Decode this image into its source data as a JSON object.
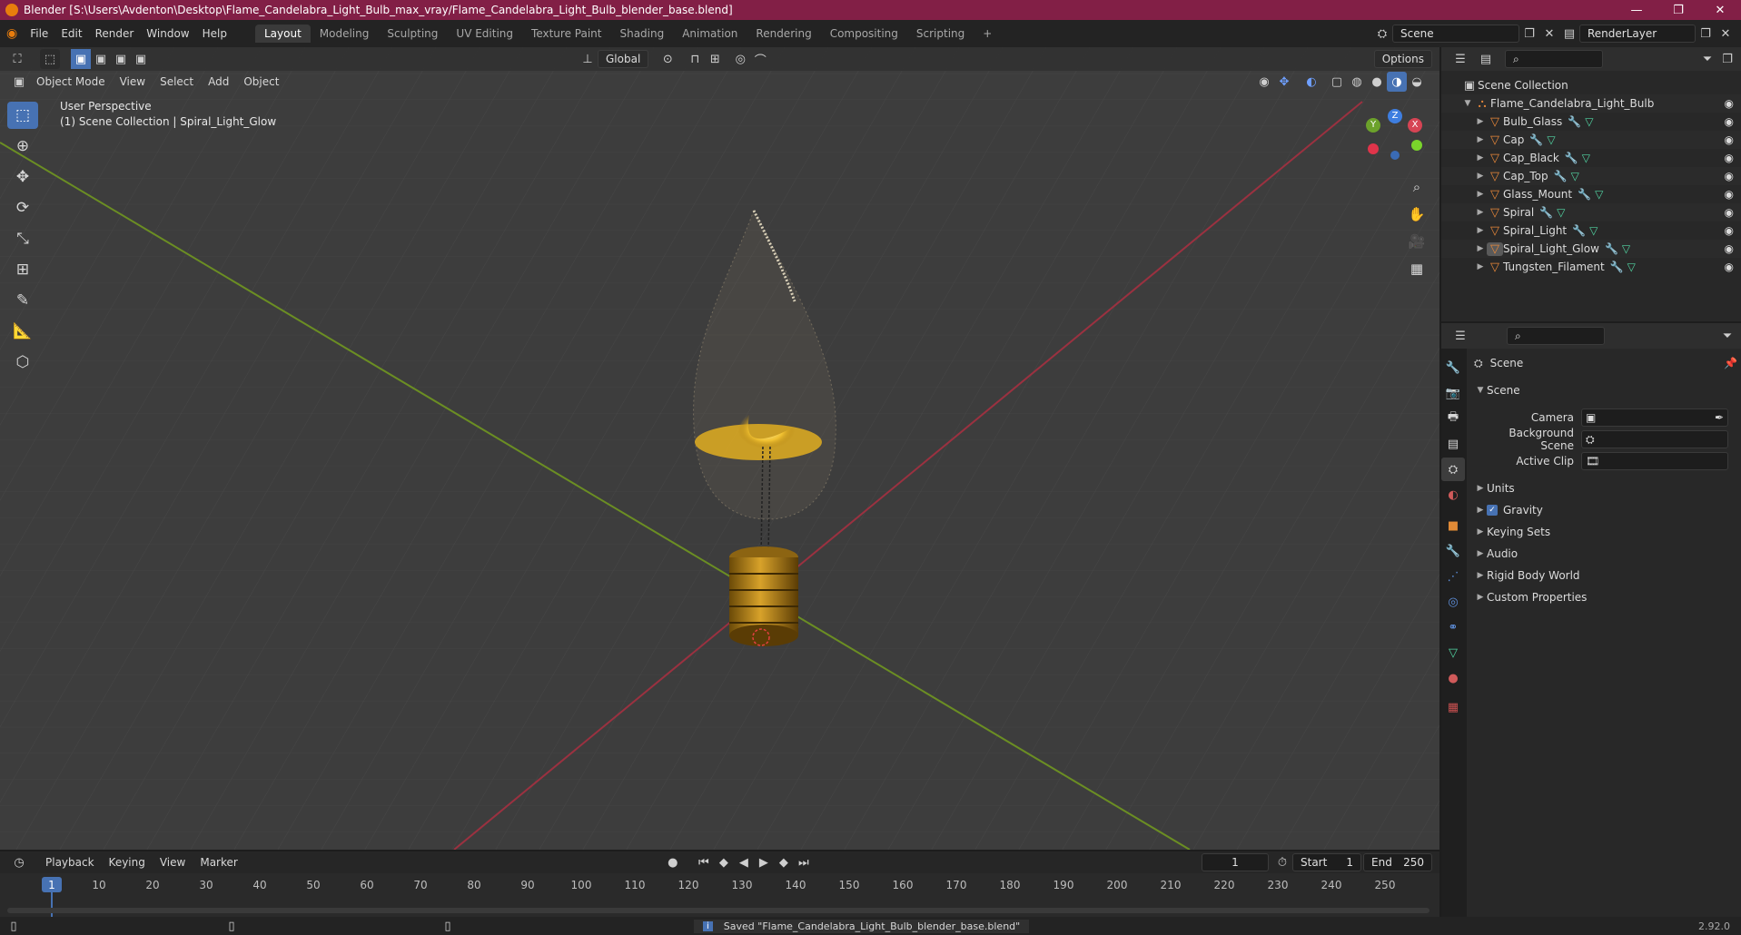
{
  "titlebar": {
    "title": "Blender [S:\\Users\\Avdenton\\Desktop\\Flame_Candelabra_Light_Bulb_max_vray/Flame_Candelabra_Light_Bulb_blender_base.blend]",
    "minimize": "—",
    "maximize": "❐",
    "close": "✕"
  },
  "menu": {
    "items": [
      "File",
      "Edit",
      "Render",
      "Window",
      "Help"
    ],
    "workspaces": [
      "Layout",
      "Modeling",
      "Sculpting",
      "UV Editing",
      "Texture Paint",
      "Shading",
      "Animation",
      "Rendering",
      "Compositing",
      "Scripting"
    ],
    "active_workspace": "Layout",
    "add_workspace": "+",
    "scene": "Scene",
    "view_layer": "RenderLayer"
  },
  "viewport": {
    "header": {
      "transform_orientation": "Global",
      "options": "Options"
    },
    "header2": {
      "mode": "Object Mode",
      "menus": [
        "View",
        "Select",
        "Add",
        "Object"
      ]
    },
    "info": {
      "perspective": "User Perspective",
      "collection": "(1) Scene Collection | Spiral_Light_Glow"
    },
    "gizmo": {
      "z": "Z",
      "y": "Y",
      "x": "X"
    }
  },
  "outliner": {
    "root": "Scene Collection",
    "collection": "Flame_Candelabra_Light_Bulb",
    "objects": [
      "Bulb_Glass",
      "Cap",
      "Cap_Black",
      "Cap_Top",
      "Glass_Mount",
      "Spiral",
      "Spiral_Light",
      "Spiral_Light_Glow",
      "Tungsten_Filament"
    ],
    "selected": "Spiral_Light_Glow"
  },
  "properties": {
    "context": "Scene",
    "panel": "Scene",
    "fields": [
      {
        "label": "Camera",
        "value": ""
      },
      {
        "label": "Background Scene",
        "value": ""
      },
      {
        "label": "Active Clip",
        "value": ""
      }
    ],
    "subpanels": [
      "Units",
      "Gravity",
      "Keying Sets",
      "Audio",
      "Rigid Body World",
      "Custom Properties"
    ],
    "gravity_checked": true,
    "tab_colors": [
      "#cfcfcf",
      "#cfcfcf",
      "#cfcfcf",
      "#cfcfcf",
      "#cfcfcf",
      "#e0704b",
      "#e08a36",
      "#5e8fdb",
      "#5e8fdb",
      "#5e8fdb",
      "#5e8fdb",
      "#52d5a3",
      "#d05a5a",
      "#c85050"
    ]
  },
  "timeline": {
    "menus": [
      "Playback",
      "Keying",
      "View",
      "Marker"
    ],
    "current_frame": "1",
    "start_label": "Start",
    "start": "1",
    "end_label": "End",
    "end": "250",
    "ticks": [
      "1",
      "10",
      "20",
      "30",
      "40",
      "50",
      "60",
      "70",
      "80",
      "90",
      "100",
      "110",
      "120",
      "130",
      "140",
      "150",
      "160",
      "170",
      "180",
      "190",
      "200",
      "210",
      "220",
      "230",
      "240",
      "250"
    ]
  },
  "status": {
    "message": "Saved \"Flame_Candelabra_Light_Bulb_blender_base.blend\"",
    "version": "2.92.0"
  }
}
